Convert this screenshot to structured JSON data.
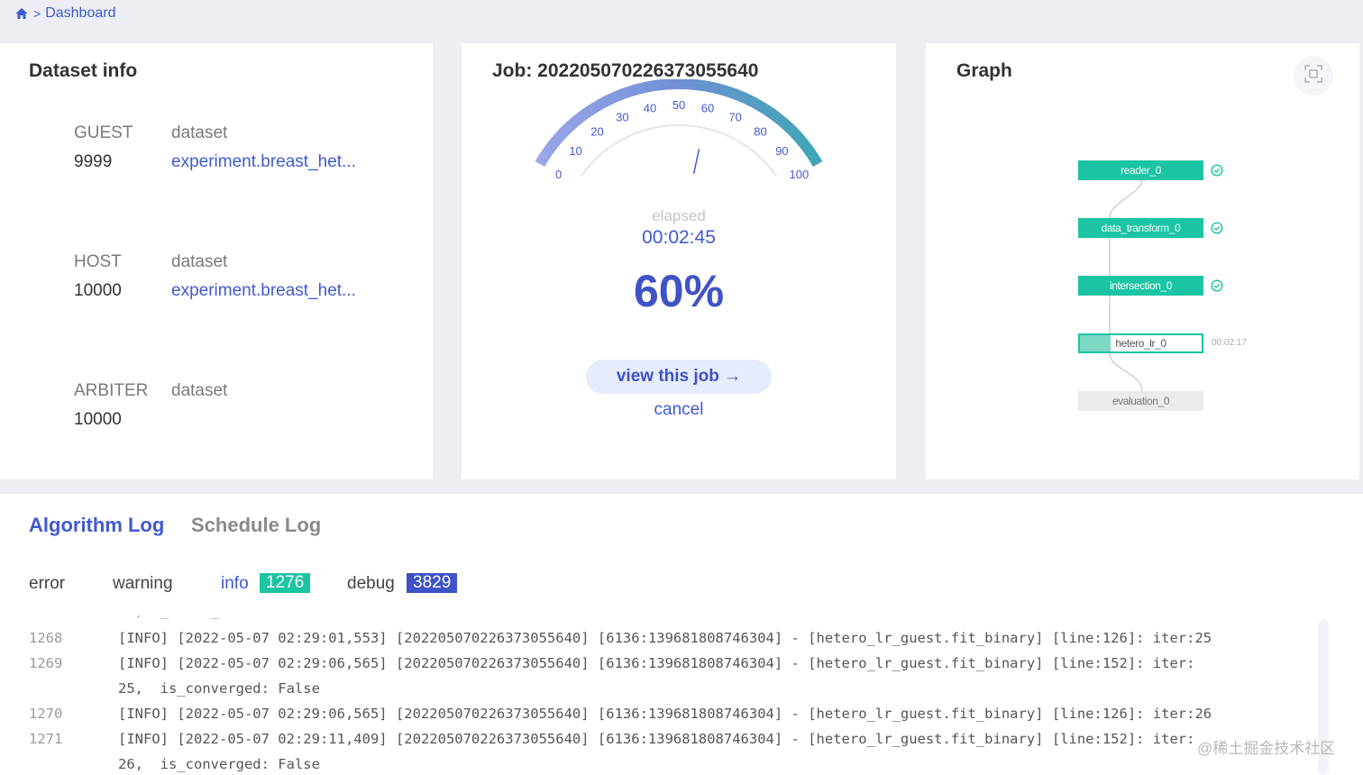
{
  "breadcrumb": {
    "current": "Dashboard"
  },
  "dataset_info": {
    "title": "Dataset info",
    "rows": [
      {
        "role": "GUEST",
        "count": "9999",
        "label": "dataset",
        "value": "experiment.breast_het..."
      },
      {
        "role": "HOST",
        "count": "10000",
        "label": "dataset",
        "value": "experiment.breast_het..."
      },
      {
        "role": "ARBITER",
        "count": "10000",
        "label": "dataset",
        "value": ""
      }
    ]
  },
  "job": {
    "title": "Job: 202205070226373055640",
    "gauge": {
      "min": 0,
      "max": 100,
      "ticks": [
        "0",
        "10",
        "20",
        "30",
        "40",
        "50",
        "60",
        "70",
        "80",
        "90",
        "100"
      ],
      "value": 60
    },
    "elapsed_label": "elapsed",
    "elapsed_time": "00:02:45",
    "percent": "60%",
    "view_label": "view this job →",
    "cancel_label": "cancel"
  },
  "graph": {
    "title": "Graph",
    "nodes": [
      {
        "name": "reader_0",
        "status": "complete"
      },
      {
        "name": "data_transform_0",
        "status": "complete"
      },
      {
        "name": "intersection_0",
        "status": "complete"
      },
      {
        "name": "hetero_lr_0",
        "status": "running",
        "progress": 0.25,
        "time": "00:02:17"
      },
      {
        "name": "evaluation_0",
        "status": "waiting"
      }
    ]
  },
  "logs": {
    "tabs": [
      {
        "label": "Algorithm Log",
        "active": true
      },
      {
        "label": "Schedule Log",
        "active": false
      }
    ],
    "filters": [
      {
        "label": "error",
        "count": ""
      },
      {
        "label": "warning",
        "count": ""
      },
      {
        "label": "info",
        "count": "1276",
        "active": true
      },
      {
        "label": "debug",
        "count": "3829"
      }
    ],
    "lines": [
      {
        "num": "1268",
        "text": "[INFO] [2022-05-07 02:29:01,553] [202205070226373055640] [6136:139681808746304] - [hetero_lr_guest.fit_binary] [line:126]: iter:25"
      },
      {
        "num": "1269",
        "text": "[INFO] [2022-05-07 02:29:06,565] [202205070226373055640] [6136:139681808746304] - [hetero_lr_guest.fit_binary] [line:152]: iter:"
      },
      {
        "num": "",
        "text": "25,  is_converged: False"
      },
      {
        "num": "1270",
        "text": "[INFO] [2022-05-07 02:29:06,565] [202205070226373055640] [6136:139681808746304] - [hetero_lr_guest.fit_binary] [line:126]: iter:26"
      },
      {
        "num": "1271",
        "text": "[INFO] [2022-05-07 02:29:11,409] [202205070226373055640] [6136:139681808746304] - [hetero_lr_guest.fit_binary] [line:152]: iter:"
      },
      {
        "num": "",
        "text": "26,  is_converged: False"
      }
    ]
  },
  "watermark": "@稀土掘金技术社区",
  "colors": {
    "accent": "#4159d1",
    "success": "#1bc4a3",
    "badge_info": "#1bc4a3",
    "badge_debug": "#3f52c7"
  }
}
